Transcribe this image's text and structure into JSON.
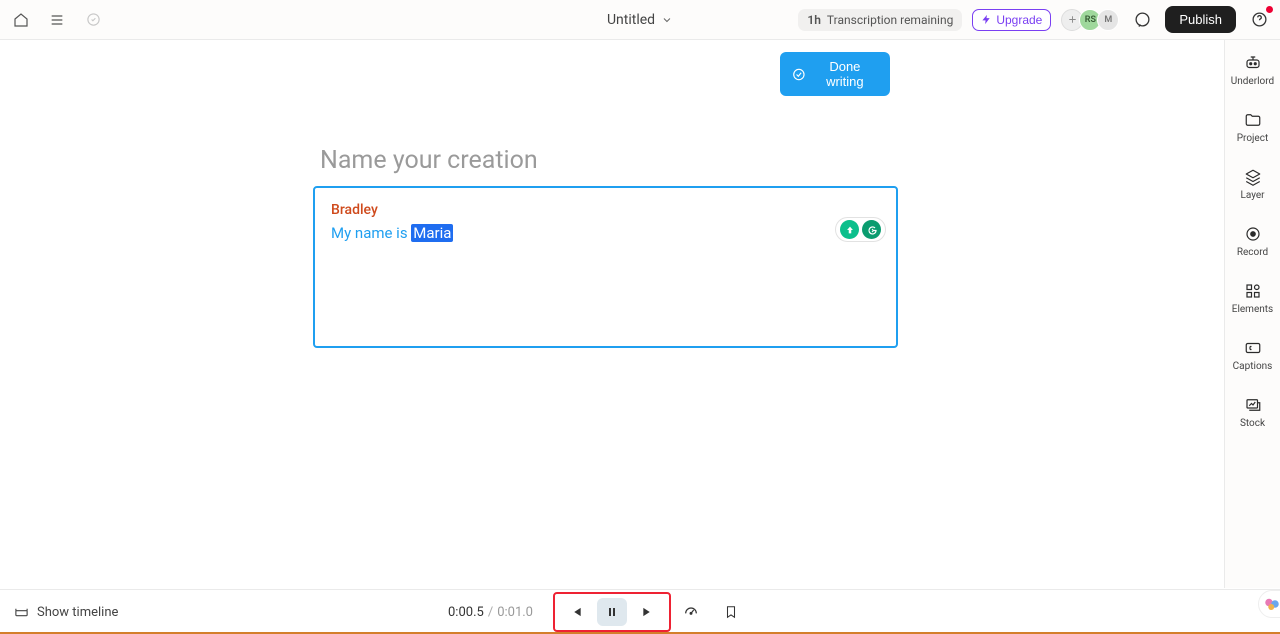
{
  "topbar": {
    "title": "Untitled",
    "transcription_prefix": "1h",
    "transcription_label": "Transcription remaining",
    "upgrade_label": "Upgrade",
    "publish_label": "Publish",
    "avatars": [
      "RS",
      "M"
    ]
  },
  "rightRail": {
    "items": [
      {
        "label": "Underlord"
      },
      {
        "label": "Project"
      },
      {
        "label": "Layer"
      },
      {
        "label": "Record"
      },
      {
        "label": "Elements"
      },
      {
        "label": "Captions"
      },
      {
        "label": "Stock"
      }
    ]
  },
  "main": {
    "done_writing_label": "Done writing",
    "title_placeholder": "Name your creation",
    "speaker": "Bradley",
    "transcript_prefix": "My name is ",
    "transcript_highlight": "Maria"
  },
  "bottom": {
    "show_timeline_label": "Show timeline",
    "time_current": "0:00.5",
    "time_sep": "/",
    "time_total": "0:01.0"
  }
}
